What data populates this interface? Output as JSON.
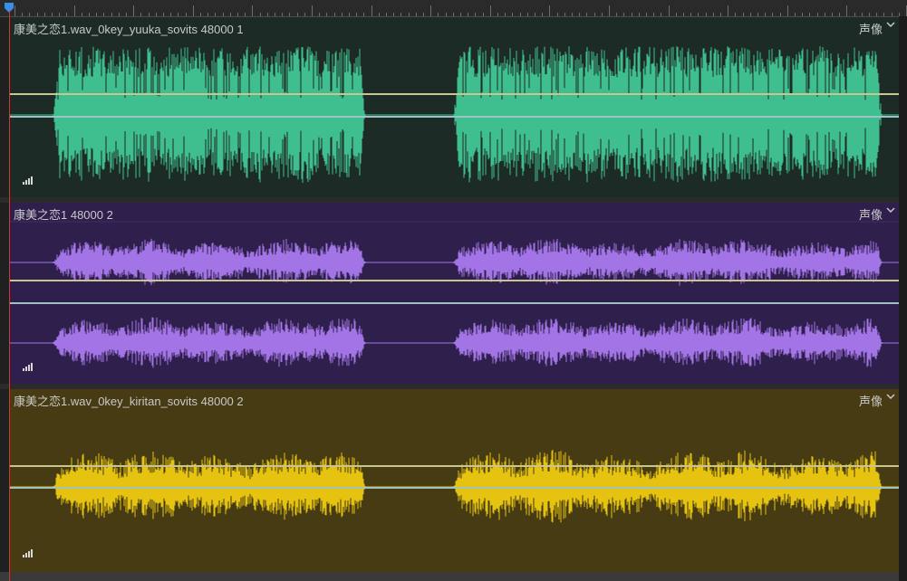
{
  "tracks": [
    {
      "title": "康美之恋1.wav_0key_yuuka_sovits 48000 1",
      "channel_label": "声像",
      "bg_color": "#1c2b26",
      "wave_color": "#3fbf8f",
      "line_color_a": "#c8c58f",
      "line_color_b": "#9fc3c3",
      "channels": 1
    },
    {
      "title": "康美之恋1 48000 2",
      "channel_label": "声像",
      "bg_color": "#2e1f4c",
      "wave_color": "#a274e6",
      "line_color_a": "#c8c58f",
      "line_color_b": "#9fc3c3",
      "channels": 2
    },
    {
      "title": "康美之恋1.wav_0key_kiritan_sovits 48000 2",
      "channel_label": "声像",
      "bg_color": "#463b13",
      "wave_color": "#e6c311",
      "line_color_a": "#c8c58f",
      "line_color_b": "#9fc3c3",
      "channels": 1
    }
  ],
  "icons": {
    "playhead": "playhead-marker-icon",
    "chevron": "chevron-down-icon",
    "meter": "signal-meter-icon"
  }
}
